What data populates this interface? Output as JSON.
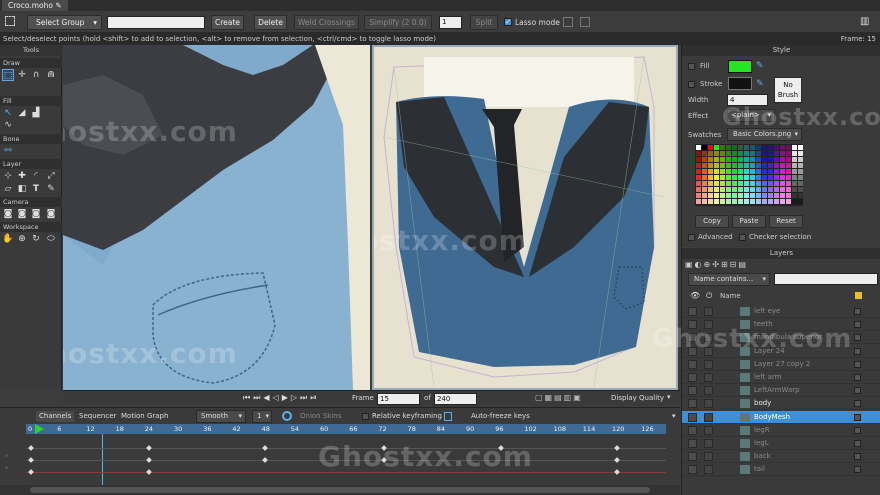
{
  "window": {
    "doc_tab": "Croco.moho"
  },
  "toolbar": {
    "select_group": "Select Group",
    "group_name_value": "",
    "create": "Create",
    "delete": "Delete",
    "weld_crossings": "Weld Crossings",
    "simplify": "Simplify (2 0.0)",
    "simplify_value": "1",
    "split": "Split",
    "lasso_mode": "Lasso mode",
    "lasso_checked": true
  },
  "status": {
    "hint": "Select/deselect points (hold <shift> to add to selection, <alt> to remove from selection, <ctrl/cmd> to toggle lasso mode)",
    "frame": "Frame: 15"
  },
  "tools": {
    "title": "Tools",
    "sections": [
      "Draw",
      "Fill",
      "Bone",
      "Layer",
      "Camera",
      "Workspace"
    ]
  },
  "canvas_controls": {
    "frame_label": "Frame",
    "frame_value": "15",
    "of_label": "of",
    "total_frames": "240",
    "display_quality": "Display Quality"
  },
  "style": {
    "title": "Style",
    "fill_label": "Fill",
    "fill_color": "#22e622",
    "stroke_label": "Stroke",
    "stroke_color": "#111111",
    "no_brush": "No Brush",
    "width_label": "Width",
    "width_value": "4",
    "effect_label": "Effect",
    "effect_value": "<plain>",
    "swatches_label": "Swatches",
    "swatches_value": "Basic Colors.png",
    "copy": "Copy",
    "paste": "Paste",
    "reset": "Reset",
    "advanced": "Advanced",
    "checker_selection": "Checker selection"
  },
  "layers": {
    "title": "Layers",
    "filter_option": "Name contains...",
    "filter_value": "",
    "name_header": "Name",
    "items": [
      {
        "name": "left eye",
        "dim": true
      },
      {
        "name": "teeth",
        "dim": true
      },
      {
        "name": "mandibula superior",
        "dim": true
      },
      {
        "name": "Layer 24",
        "dim": true
      },
      {
        "name": "Layer 27 copy 2",
        "dim": true
      },
      {
        "name": "left arm",
        "dim": true
      },
      {
        "name": "LeftArmWarp",
        "dim": true
      },
      {
        "name": "body",
        "dim": false
      },
      {
        "name": "BodyMesh",
        "dim": false,
        "selected": true
      },
      {
        "name": "legR",
        "dim": true
      },
      {
        "name": "legL",
        "dim": true
      },
      {
        "name": "back",
        "dim": true
      },
      {
        "name": "tail",
        "dim": true
      }
    ]
  },
  "timeline": {
    "tabs": [
      "Channels",
      "Sequencer",
      "Motion Graph"
    ],
    "interp": "Smooth",
    "interp_num": "1",
    "onion_skins": "Onion Skins",
    "relative_keyframing": "Relative keyframing",
    "auto_freeze": "Auto-freeze keys",
    "ruler": [
      "0",
      "6",
      "12",
      "18",
      "24",
      "30",
      "36",
      "42",
      "48",
      "54",
      "60",
      "66",
      "72",
      "78",
      "84",
      "90",
      "96",
      "102",
      "108",
      "114",
      "120",
      "126"
    ]
  },
  "watermark": "Ghostxx.com",
  "colors": {
    "accent": "#3f6a96",
    "selection": "#3d8fd6"
  }
}
